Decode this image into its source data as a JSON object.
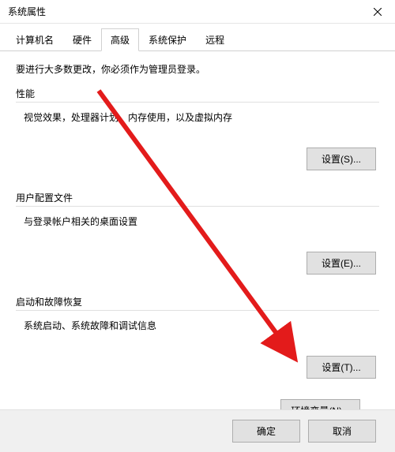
{
  "window": {
    "title": "系统属性"
  },
  "tabs": {
    "computer_name": "计算机名",
    "hardware": "硬件",
    "advanced": "高级",
    "system_protection": "系统保护",
    "remote": "远程"
  },
  "admin_note": "要进行大多数更改，你必须作为管理员登录。",
  "performance": {
    "title": "性能",
    "desc": "视觉效果，处理器计划，内存使用，以及虚拟内存",
    "button": "设置(S)..."
  },
  "user_profiles": {
    "title": "用户配置文件",
    "desc": "与登录帐户相关的桌面设置",
    "button": "设置(E)..."
  },
  "startup_recovery": {
    "title": "启动和故障恢复",
    "desc": "系统启动、系统故障和调试信息",
    "button": "设置(T)..."
  },
  "env_vars_button": "环境变量(N)...",
  "bottom": {
    "ok": "确定",
    "cancel": "取消"
  },
  "annotation": {
    "arrow_color": "#e31b1b"
  }
}
